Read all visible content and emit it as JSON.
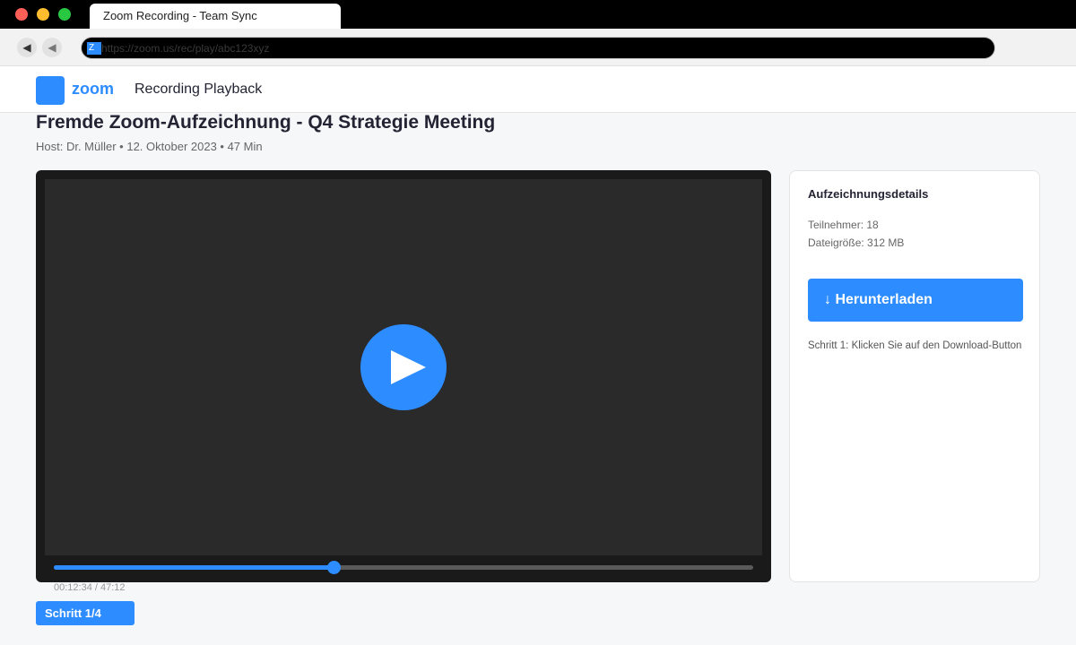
{
  "browser": {
    "tab_title": "Zoom Recording - Team Sync",
    "favicon_letter": "Z",
    "url": "https://zoom.us/rec/play/abc123xyz"
  },
  "app": {
    "logo_text": "zoom",
    "header_title": "Recording Playback",
    "brand_color": "#2d8cff"
  },
  "recording": {
    "title": "Fremde Zoom-Aufzeichnung - Q4 Strategie Meeting",
    "meta": "Host: Dr. Müller • 12. Oktober 2023 • 47 Min"
  },
  "player": {
    "time_display": "00:12:34 / 47:12",
    "progress_fraction": 0.4
  },
  "step_badge": "Schritt 1/4",
  "panel": {
    "heading": "Aufzeichnungsdetails",
    "participants": "Teilnehmer: 18",
    "filesize": "Dateigröße: 312 MB",
    "download_label": "↓ Herunterladen",
    "step_hint": "Schritt 1: Klicken Sie auf den Download-Button"
  }
}
